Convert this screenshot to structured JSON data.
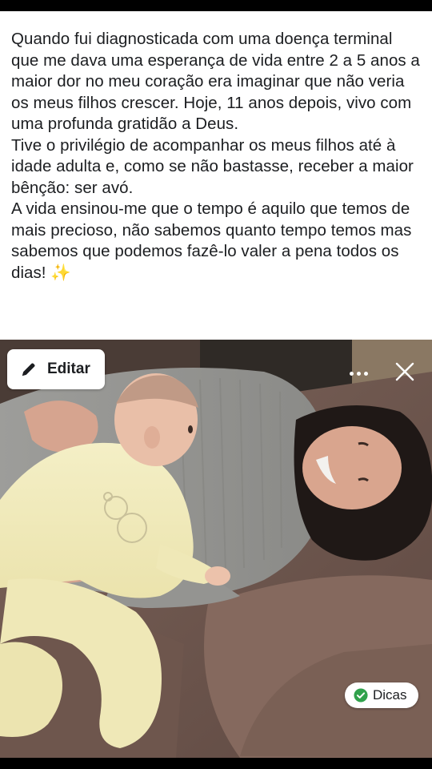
{
  "post": {
    "paragraphs": [
      "Quando fui diagnosticada com uma doença terminal que me dava uma esperança de vida entre 2 a 5 anos a maior dor no meu coração era imaginar que não veria os meus filhos crescer. Hoje, 11 anos depois, vivo com uma profunda gratidão a Deus.",
      "Tive o privilégio de acompanhar os meus filhos até à idade adulta e, como se não bastasse, receber a maior bênção: ser avó.",
      "A vida ensinou-me que o tempo é aquilo que temos de mais precioso, não sabemos quanto tempo temos mas sabemos que podemos fazê-lo valer a pena todos os dias!"
    ],
    "emoji": "✨"
  },
  "photo_toolbar": {
    "edit_label": "Editar",
    "edit_icon": "pencil-icon",
    "more_icon": "more-options-icon",
    "close_icon": "close-icon"
  },
  "tips": {
    "label": "Dicas",
    "icon": "check-circle-icon",
    "icon_color": "#31a24c"
  }
}
